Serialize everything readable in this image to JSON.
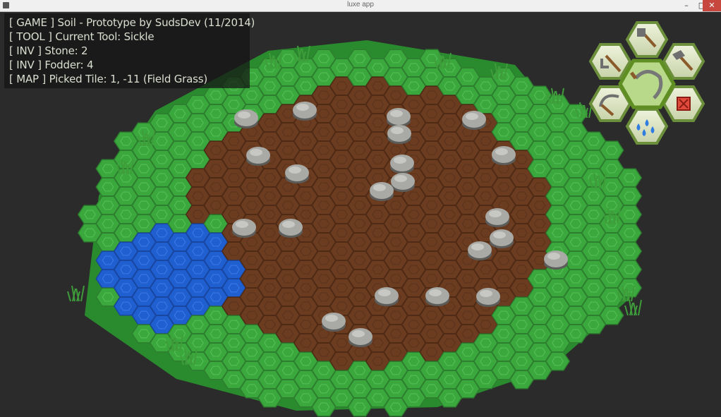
{
  "window": {
    "title": "luxe app",
    "minimize_label": "–",
    "maximize_label": "□",
    "close_label": "✕"
  },
  "hud": {
    "lines": [
      "[ GAME ] Soil - Prototype by SudsDev (11/2014)",
      "[ TOOL ] Current Tool: Sickle",
      "[ INV ] Stone: 2",
      "[ INV ] Fodder: 4",
      "[ MAP ] Picked Tile: 1, -11 (Field Grass)"
    ]
  },
  "toolwheel": {
    "selected_tool": "sickle",
    "tools": [
      {
        "id": "shovel",
        "icon": "shovel-icon"
      },
      {
        "id": "hoe",
        "icon": "hoe-icon"
      },
      {
        "id": "hammer",
        "icon": "hammer-icon"
      },
      {
        "id": "sickle-selected",
        "icon": "sickle-icon"
      },
      {
        "id": "scythe",
        "icon": "scythe-icon"
      },
      {
        "id": "cancel",
        "icon": "cancel-icon"
      },
      {
        "id": "watering",
        "icon": "water-drops-icon"
      }
    ]
  },
  "colors": {
    "grass": "#3aa83c",
    "grass_dark": "#2a8a2e",
    "soil": "#6b3c20",
    "soil_dark": "#4f2a15",
    "water": "#1f5fd0",
    "stone": "#a9aaa5",
    "tool_bg": "#dfe6c8",
    "tool_border": "#6c8f3b"
  }
}
